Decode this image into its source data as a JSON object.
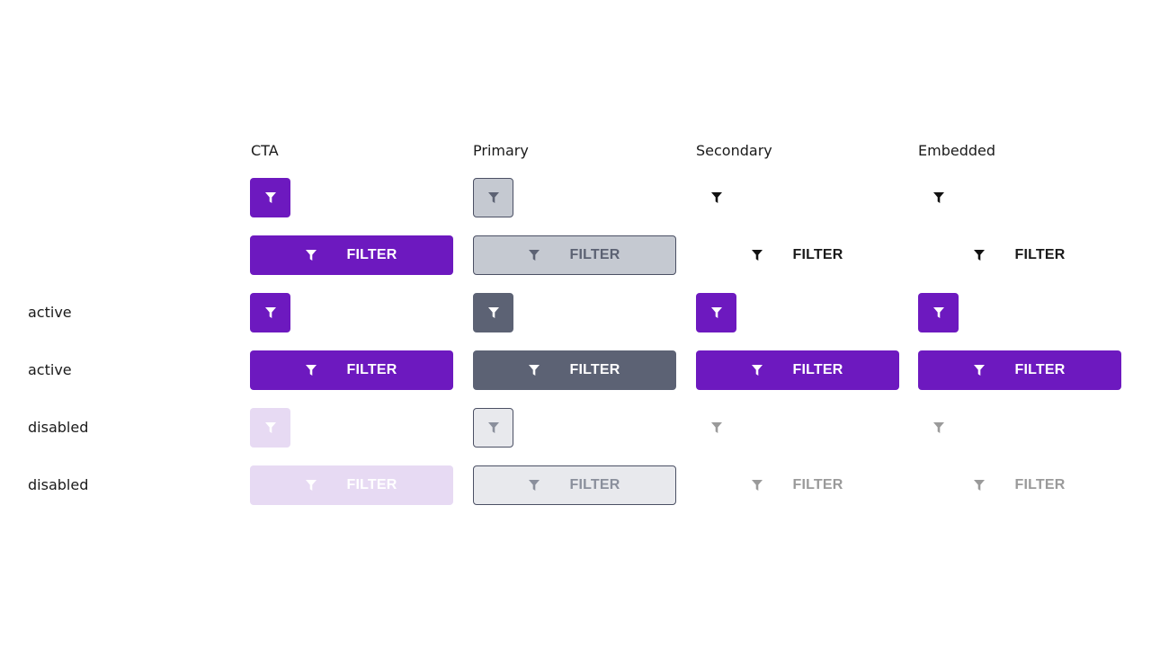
{
  "columns": {
    "cta": "CTA",
    "primary": "Primary",
    "secondary": "Secondary",
    "embedded": "Embedded"
  },
  "rows": {
    "active_label": "active",
    "disabled_label": "disabled"
  },
  "button": {
    "label": "FILTER",
    "icon": "filter-funnel-icon"
  },
  "colors": {
    "cta": "#6d19bf",
    "cta_disabled": "#e7daf3",
    "primary_bg": "#c5c9d1",
    "primary_active": "#5c6274",
    "primary_disabled": "#e8e9ed",
    "border": "#4b5064"
  }
}
